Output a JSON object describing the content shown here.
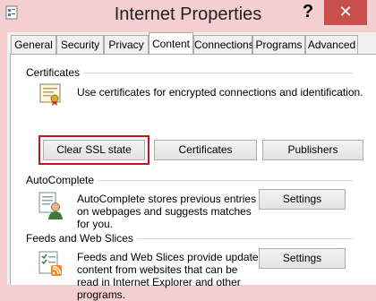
{
  "window": {
    "title": "Internet Properties",
    "help_label": "?",
    "close_label": "✕",
    "icons": {
      "app": "internet-options-icon",
      "help": "help-icon",
      "close": "close-icon"
    }
  },
  "tabs": [
    {
      "label": "General",
      "active": false
    },
    {
      "label": "Security",
      "active": false
    },
    {
      "label": "Privacy",
      "active": false
    },
    {
      "label": "Content",
      "active": true
    },
    {
      "label": "Connections",
      "active": false
    },
    {
      "label": "Programs",
      "active": false
    },
    {
      "label": "Advanced",
      "active": false
    }
  ],
  "certificates": {
    "heading": "Certificates",
    "description": "Use certificates for encrypted connections and identification.",
    "icon": "certificate-icon",
    "buttons": {
      "clear_ssl": "Clear SSL state",
      "certificates": "Certificates",
      "publishers": "Publishers"
    },
    "highlighted_button": "Clear SSL state",
    "highlight_color": "#d0101c"
  },
  "autocomplete": {
    "heading": "AutoComplete",
    "lines": [
      "AutoComplete stores previous entries",
      "on webpages and suggests matches",
      "for you."
    ],
    "icon": "autocomplete-user-icon",
    "settings_label": "Settings"
  },
  "feeds": {
    "heading": "Feeds and Web Slices",
    "lines": [
      "Feeds and Web Slices provide updated",
      "content from websites that can be",
      "read in Internet Explorer and other",
      "programs."
    ],
    "icon": "feeds-rss-icon",
    "settings_label": "Settings"
  },
  "colors": {
    "title_bar": "#f5cfd0",
    "close_button": "#c7504f",
    "panel": "#ffffff"
  }
}
